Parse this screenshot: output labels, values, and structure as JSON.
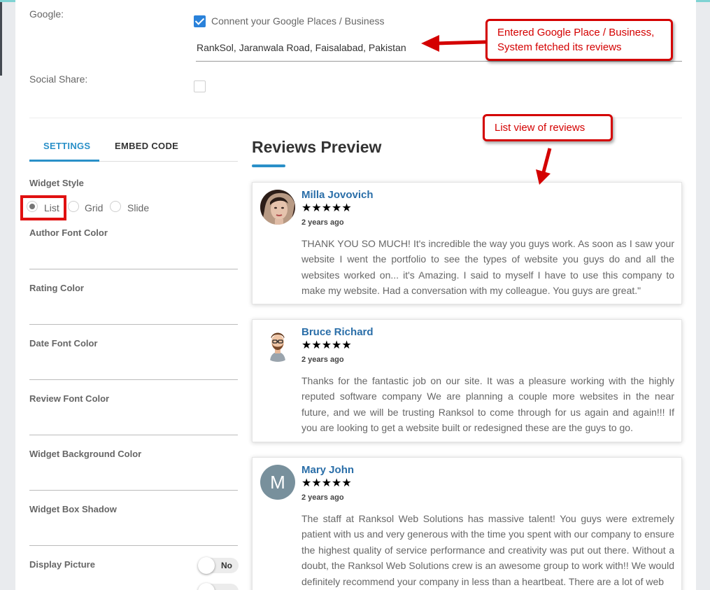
{
  "form": {
    "google_label": "Google:",
    "google_checkbox_text": "Connent your Google Places / Business",
    "google_checked": true,
    "place_value": "RankSol, Jaranwala Road, Faisalabad, Pakistan",
    "social_label": "Social Share:",
    "social_checked": false
  },
  "tabs": [
    {
      "label": "SETTINGS",
      "active": true
    },
    {
      "label": "EMBED CODE",
      "active": false
    }
  ],
  "settings": {
    "widget_style_label": "Widget Style",
    "style_options": [
      "List",
      "Grid",
      "Slide"
    ],
    "selected_style": "List",
    "fields": [
      "Author Font Color",
      "Rating Color",
      "Date Font Color",
      "Review Font Color",
      "Widget Background Color",
      "Widget Box Shadow"
    ],
    "display_picture_label": "Display Picture",
    "display_picture_value": "No"
  },
  "preview": {
    "title": "Reviews Preview",
    "reviews": [
      {
        "name": "Milla Jovovich",
        "stars": "★★★★★",
        "date": "2 years ago",
        "text": "THANK YOU SO MUCH! It's incredible the way you guys work. As soon as I saw your website I went the portfolio to see the types of website you guys do and all the websites worked on... it's Amazing. I said to myself I have to use this company to make my website. Had a conversation with my colleague. You guys are great.\""
      },
      {
        "name": "Bruce Richard",
        "stars": "★★★★★",
        "date": "2 years ago",
        "text": "Thanks for the fantastic job on our site. It was a pleasure working with the highly reputed software company We are planning a couple more websites in the near future, and we will be trusting Ranksol to come through for us again and again!!! If you are looking to get a website built or redesigned these are the guys to go."
      },
      {
        "name": "Mary John",
        "initial": "M",
        "stars": "★★★★★",
        "date": "2 years ago",
        "text": "The staff at Ranksol Web Solutions has massive talent! You guys were extremely patient with us and very generous with the time you spent with our company to ensure the highest quality of service performance and creativity was put out there. Without a doubt, the Ranksol Web Solutions crew is an awesome group to work with!! We would definitely recommend your company in less than a heartbeat. There are a lot of web"
      }
    ]
  },
  "annotations": {
    "callout1": "Entered Google Place / Business, System fetched its reviews",
    "callout2": "List view of reviews"
  },
  "colors": {
    "accent": "#2a90c8",
    "annotation_red": "#d40000",
    "checkbox_blue": "#2a82da"
  }
}
